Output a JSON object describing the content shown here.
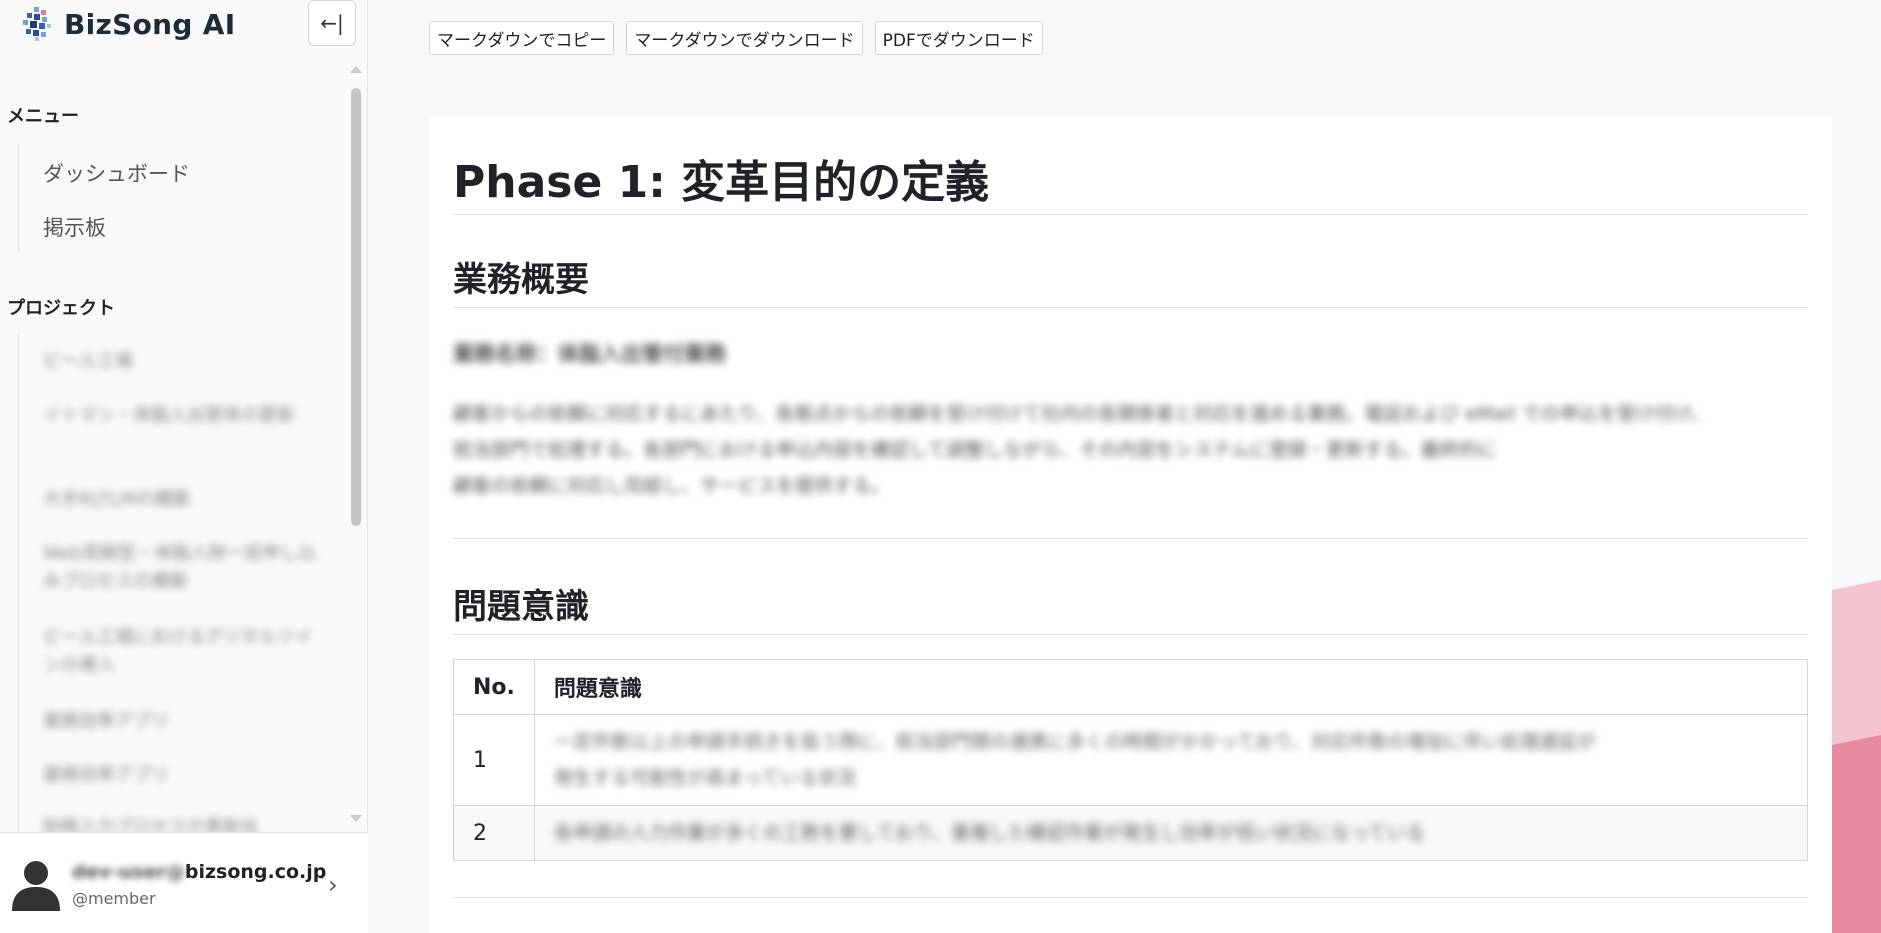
{
  "brand": {
    "name": "BizSong AI"
  },
  "sidebar": {
    "collapse_icon": "←|",
    "menu_title": "メニュー",
    "menu_items": [
      {
        "label": "ダッシュボード"
      },
      {
        "label": "掲示板"
      }
    ],
    "projects_title": "プロジェクト",
    "projects": [
      {
        "label": "ビール工場"
      },
      {
        "label": "イトマン・体脂入出管体の更新"
      },
      {
        "label": "大手RLTLMの構築"
      },
      {
        "label": "Web受献型・体脂入財一括申し込みプロセスの構築"
      },
      {
        "label": "ビール工場におけるデジタルツインの導入"
      },
      {
        "label": "業務効率アプリ"
      },
      {
        "label": "業務効率アプリ"
      },
      {
        "label": "財務入力プロセスの更新化"
      }
    ]
  },
  "user": {
    "email_hidden": "dev-user@",
    "email_domain": "bizsong.co.jp",
    "role": "@member"
  },
  "toolbar": {
    "copy_md": "マークダウンでコピー",
    "download_md": "マークダウンでダウンロード",
    "download_pdf": "PDFでダウンロード"
  },
  "doc": {
    "title": "Phase 1: 変革目的の定義",
    "section1_title": "業務概要",
    "section1_subtitle": "業務名称：体脂入出管付業務",
    "section1_body_lines": [
      "顧客からの依頼に対応するにあたり、各拠点からの依頼を受け付けて社内の各関係者と対応を進める業務。電話および eMail での申込を受け付け、",
      "担当部門で処理する。各部門における申込内容を確認して調整しながら、その内容をシステムに登録・更新する。最終的に",
      "顧客の依頼に対応し完結し、サービスを提供する。"
    ],
    "section2_title": "問題意識",
    "table": {
      "headers": [
        "No.",
        "問題意識"
      ],
      "rows": [
        {
          "no": "1",
          "text_line1": "一定件数以上の申請手続きを扱う際に、担当部門間の連携に多くの時間がかかっており、対応件数の増加に伴い処理遅延が",
          "text_line2": "発生する可能性が高まっている状況"
        },
        {
          "no": "2",
          "text_line1": "各申請の入力作業が多くの工数を要しており、重複した確認作業が発生し効率が低い状況になっている"
        }
      ]
    }
  },
  "icons": {
    "brand_logo": "bizsong-logo-icon",
    "collapse": "collapse-sidebar-icon",
    "avatar": "user-avatar-icon",
    "chevron": "chevron-right-icon"
  }
}
